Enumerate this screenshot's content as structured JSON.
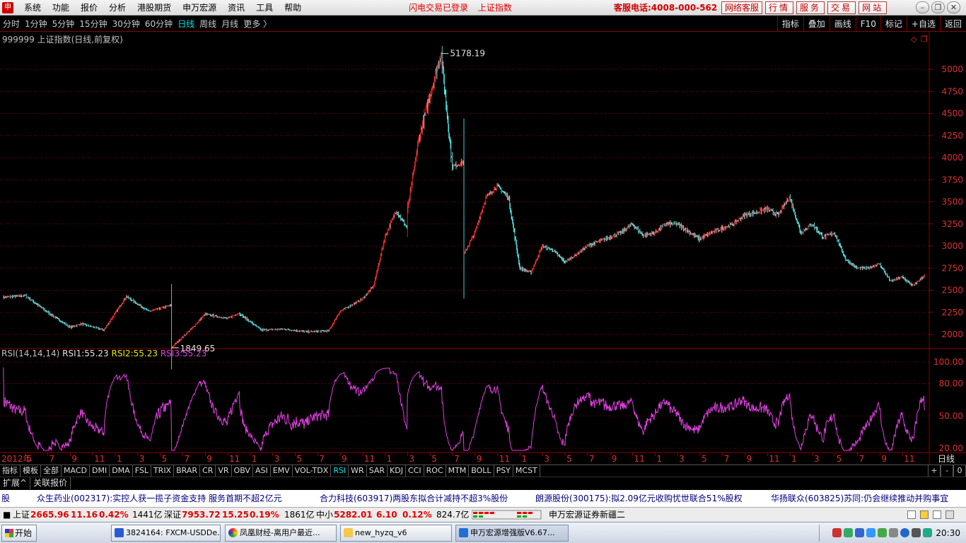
{
  "menubar": {
    "items": [
      "系统",
      "功能",
      "报价",
      "分析",
      "港股期货",
      "申万宏源",
      "资讯",
      "工具",
      "帮助"
    ],
    "notice": [
      "闪电交易已登录",
      "上证指数"
    ],
    "hotline": "客服电话:4008-000-562",
    "buttons": [
      "网络客服",
      "行情",
      "服务",
      "交易",
      "网站"
    ]
  },
  "periodbar": {
    "periods": [
      "分时",
      "1分钟",
      "5分钟",
      "15分钟",
      "30分钟",
      "60分钟",
      "日线",
      "周线",
      "月线",
      "更多 〉"
    ],
    "active_period": "日线",
    "tools": [
      "指标",
      "叠加",
      "画线",
      "F10",
      "标记",
      "+自选",
      "返回"
    ]
  },
  "chart_main": {
    "label": "999999 上证指数(日线,前复权)",
    "high_label": "5178.19",
    "low_label": "1849.65",
    "yticks": [
      2000,
      2250,
      2500,
      2750,
      3000,
      3250,
      3500,
      3750,
      4000,
      4250,
      4500,
      4750,
      5000
    ]
  },
  "chart_rsi": {
    "legend_name": "RSI(14,14,14)",
    "rsi1_label": "RSI1:",
    "rsi1": "55.23",
    "rsi2_label": "RSI2:",
    "rsi2": "55.23",
    "rsi3_label": "RSI3:",
    "rsi3": "55.23",
    "yticks": [
      "100.00",
      "80.00",
      "50.00",
      "20.00"
    ]
  },
  "xaxis": {
    "start": "2012年",
    "months": [
      "5",
      "7",
      "9",
      "11",
      "1",
      "3",
      "5",
      "7",
      "9",
      "11",
      "1",
      "3",
      "5",
      "7",
      "9",
      "11",
      "1",
      "3",
      "5",
      "7",
      "9",
      "11",
      "1",
      "3",
      "5",
      "7",
      "9",
      "11",
      "1",
      "3",
      "5",
      "7",
      "9",
      "11",
      "1",
      "3",
      "5",
      "7",
      "9",
      "11"
    ],
    "period_label": "日线"
  },
  "indicator_tabs": [
    "指标",
    "模板",
    "全部",
    "MACD",
    "DMI",
    "DMA",
    "FSL",
    "TRIX",
    "BRAR",
    "CR",
    "VR",
    "OBV",
    "ASI",
    "EMV",
    "VOL-TDX",
    "RSI",
    "WR",
    "SAR",
    "KDJ",
    "CCI",
    "ROC",
    "MTM",
    "BOLL",
    "PSY",
    "MCST"
  ],
  "active_indicator": "RSI",
  "zoom": [
    "+",
    "-",
    "0"
  ],
  "expand_bar": [
    "扩展^",
    "关联报价"
  ],
  "ticker": [
    "股",
    "众生药业(002317):实控人获一揽子资金支持 服务首期不超2亿元",
    "合力科技(603917)两股东拟合计减持不超3%股份",
    "朗源股份(300175):拟2.09亿元收购忧世联合51%股权",
    "华扬联众(603825)苏同:仍会继续推动并购事宜"
  ],
  "status": {
    "sh_label": "上证",
    "sh_price": "2665.96",
    "sh_change": "11.16",
    "sh_pct": "0.42%",
    "sh_amount": "1441亿",
    "sz_label": "深证",
    "sz_price": "7953.72",
    "sz_change": "15.25",
    "sz_pct": "0.19%",
    "sz_amount": "1861亿",
    "zx_label": "中小",
    "zx_price": "5282.01",
    "zx_change": "6.10",
    "zx_pct": "0.12%",
    "zx_amount": "824.7亿",
    "broker": "申万宏源证券新疆二"
  },
  "taskbar": {
    "start": "开始",
    "tasks": [
      "3824164: FXCM-USDDe...",
      "凤凰财经-离用户最近...",
      "new_hyzq_v6",
      "申万宏源增强版V6.67..."
    ],
    "clock": "20:30"
  },
  "colors": {
    "up": "#ff3232",
    "down": "#54ffff",
    "rsi_line": "#e040e0",
    "grid": "#8b0000",
    "accent_cyan": "#00e0e0"
  },
  "chart_data": [
    {
      "type": "candlestick",
      "title": "999999 上证指数(日线,前复权)",
      "x_start": "2012年",
      "ylim": [
        1849.65,
        5178.19
      ],
      "annotations": [
        {
          "text": "5178.19",
          "kind": "high"
        },
        {
          "text": "1849.65",
          "kind": "low"
        }
      ],
      "close_path": [
        [
          "2012-03",
          2420
        ],
        [
          "2012-05",
          2440
        ],
        [
          "2012-07",
          2250
        ],
        [
          "2012-09",
          2080
        ],
        [
          "2012-10",
          2120
        ],
        [
          "2012-12",
          2050
        ],
        [
          "2013-02",
          2430
        ],
        [
          "2013-04",
          2260
        ],
        [
          "2013-06",
          2330
        ],
        [
          "2013-06",
          1849.65
        ],
        [
          "2013-08",
          2090
        ],
        [
          "2013-09",
          2230
        ],
        [
          "2013-11",
          2180
        ],
        [
          "2013-12",
          2240
        ],
        [
          "2014-02",
          2050
        ],
        [
          "2014-04",
          2060
        ],
        [
          "2014-06",
          2030
        ],
        [
          "2014-08",
          2040
        ],
        [
          "2014-09",
          2260
        ],
        [
          "2014-11",
          2400
        ],
        [
          "2014-12",
          2550
        ],
        [
          "2015-01",
          3100
        ],
        [
          "2015-02",
          3400
        ],
        [
          "2015-03",
          3200
        ],
        [
          "2015-03",
          3400
        ],
        [
          "2015-04",
          4200
        ],
        [
          "2015-05",
          4700
        ],
        [
          "2015-06",
          5178.19
        ],
        [
          "2015-07",
          3900
        ],
        [
          "2015-08",
          3950
        ],
        [
          "2015-08",
          2900
        ],
        [
          "2015-09",
          3150
        ],
        [
          "2015-10",
          3550
        ],
        [
          "2015-11",
          3680
        ],
        [
          "2015-12",
          3550
        ],
        [
          "2016-01",
          2750
        ],
        [
          "2016-02",
          2700
        ],
        [
          "2016-03",
          3000
        ],
        [
          "2016-04",
          2950
        ],
        [
          "2016-05",
          2820
        ],
        [
          "2016-06",
          2900
        ],
        [
          "2016-07",
          3000
        ],
        [
          "2016-08",
          3050
        ],
        [
          "2016-09",
          3100
        ],
        [
          "2016-10",
          3150
        ],
        [
          "2016-11",
          3250
        ],
        [
          "2016-12",
          3120
        ],
        [
          "2017-01",
          3150
        ],
        [
          "2017-02",
          3250
        ],
        [
          "2017-03",
          3250
        ],
        [
          "2017-05",
          3080
        ],
        [
          "2017-06",
          3150
        ],
        [
          "2017-07",
          3200
        ],
        [
          "2017-08",
          3250
        ],
        [
          "2017-09",
          3350
        ],
        [
          "2017-10",
          3380
        ],
        [
          "2017-11",
          3420
        ],
        [
          "2017-12",
          3350
        ],
        [
          "2018-01",
          3560
        ],
        [
          "2018-02",
          3150
        ],
        [
          "2018-03",
          3250
        ],
        [
          "2018-04",
          3100
        ],
        [
          "2018-05",
          3150
        ],
        [
          "2018-06",
          2850
        ],
        [
          "2018-07",
          2750
        ],
        [
          "2018-08",
          2750
        ],
        [
          "2018-09",
          2800
        ],
        [
          "2018-10",
          2600
        ],
        [
          "2018-11",
          2650
        ],
        [
          "2018-12",
          2550
        ],
        [
          "2019-01",
          2665.96
        ]
      ],
      "series": [
        {
          "values": "OHLC daily candles"
        }
      ]
    },
    {
      "type": "line",
      "title": "RSI(14,14,14)",
      "ylim": [
        20,
        100
      ],
      "yticks": [
        100,
        80,
        50,
        20
      ],
      "series": [
        {
          "name": "RSI1",
          "last": 55.23
        },
        {
          "name": "RSI2",
          "last": 55.23
        },
        {
          "name": "RSI3",
          "last": 55.23
        }
      ]
    }
  ]
}
